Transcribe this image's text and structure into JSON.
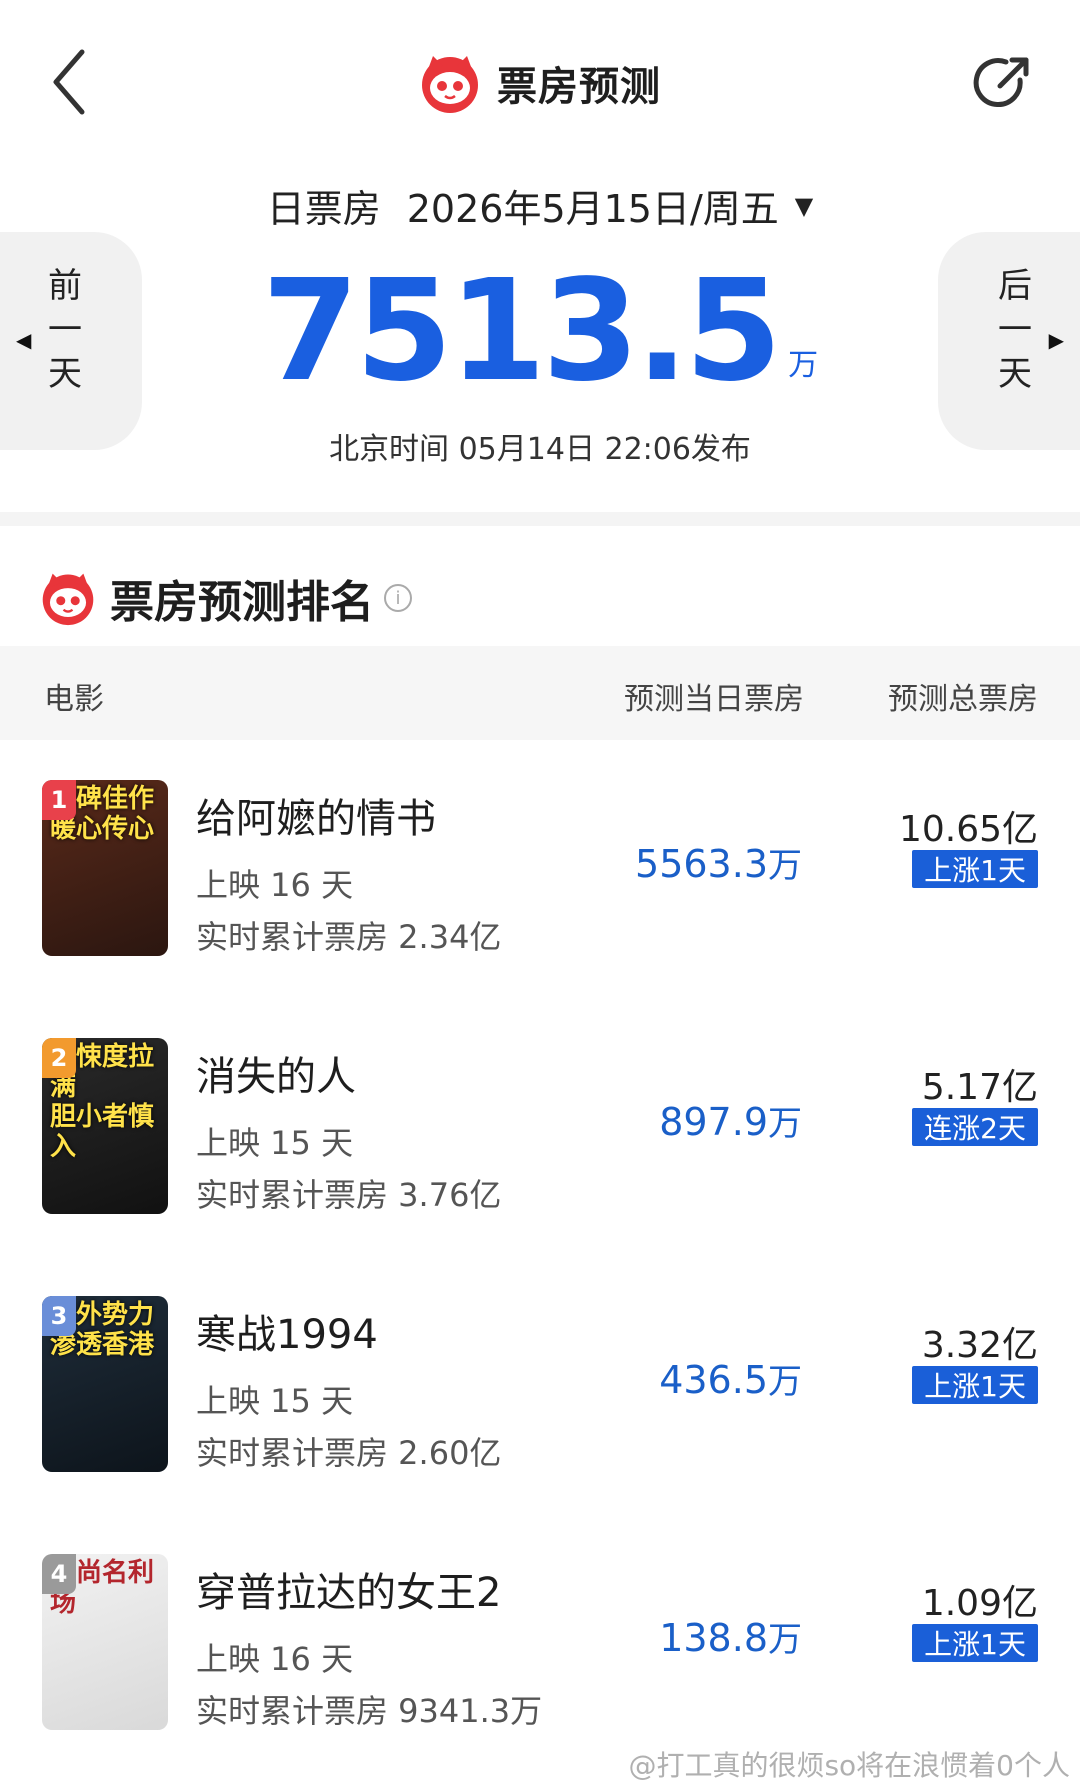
{
  "header": {
    "title": "票房预测"
  },
  "date_selector": {
    "label": "日票房",
    "value": "2026年5月15日/周五"
  },
  "nav": {
    "prev": [
      "前",
      "一",
      "天"
    ],
    "next": [
      "后",
      "一",
      "天"
    ]
  },
  "summary": {
    "total": "7513.5",
    "unit": "万",
    "publish_time": "北京时间  05月14日  22:06发布"
  },
  "ranking": {
    "title": "票房预测排名",
    "columns": {
      "movie": "电影",
      "today": "预测当日票房",
      "total": "预测总票房"
    },
    "rows": [
      {
        "rank": "1",
        "name": "给阿嬷的情书",
        "days": "上映 16 天",
        "cumulative": "实时累计票房 2.34亿",
        "today_num": "5563.3",
        "today_unit": "万",
        "total": "10.65亿",
        "trend": "上涨1天",
        "poster_text": "口碑佳作\n暖心传心",
        "badge_color": "#e8414b",
        "poster_colors": [
          "#5a2a1a",
          "#2b1610"
        ]
      },
      {
        "rank": "2",
        "name": "消失的人",
        "days": "上映 15 天",
        "cumulative": "实时累计票房 3.76亿",
        "today_num": "897.9",
        "today_unit": "万",
        "total": "5.17亿",
        "trend": "连涨2天",
        "poster_text": "惊悚度拉满\n胆小者慎入",
        "badge_color": "#f29a2e",
        "poster_colors": [
          "#2a2a2a",
          "#111111"
        ]
      },
      {
        "rank": "3",
        "name": "寒战1994",
        "days": "上映 15 天",
        "cumulative": "实时累计票房 2.60亿",
        "today_num": "436.5",
        "today_unit": "万",
        "total": "3.32亿",
        "trend": "上涨1天",
        "poster_text": "境外势力\n渗透香港",
        "badge_color": "#6a8ed8",
        "poster_colors": [
          "#1f2d3a",
          "#0d141b"
        ]
      },
      {
        "rank": "4",
        "name": "穿普拉达的女王2",
        "days": "上映 16 天",
        "cumulative": "实时累计票房 9341.3万",
        "today_num": "138.8",
        "today_unit": "万",
        "total": "1.09亿",
        "trend": "上涨1天",
        "poster_text": "时尚名利场",
        "badge_color": "#9a9a9a",
        "poster_colors": [
          "#f2f2f2",
          "#d9d9d9"
        ]
      }
    ]
  },
  "watermark": "@打工真的很烦so将在浪惯着0个人"
}
